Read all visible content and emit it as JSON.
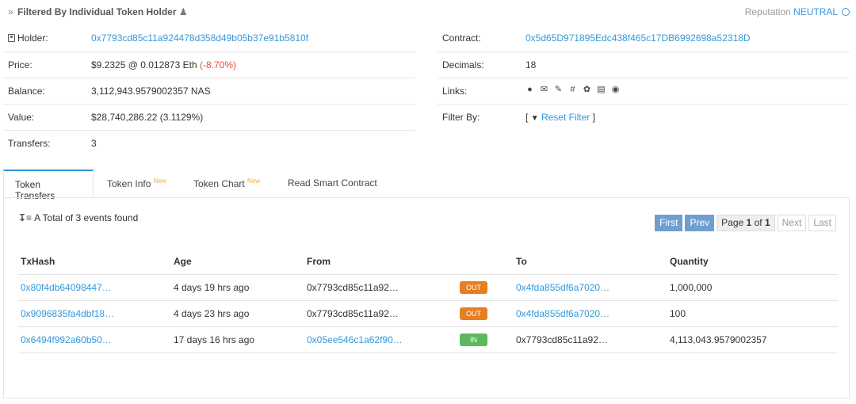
{
  "header": {
    "filter_title": "Filtered By Individual Token Holder",
    "reputation_label": "Reputation",
    "reputation_value": "NEUTRAL"
  },
  "overview_left": [
    {
      "label": "Holder:",
      "value": "0x7793cd85c11a924478d358d49b05b37e91b5810f",
      "is_link": true,
      "has_icon": true
    },
    {
      "label": "Price:",
      "value": "$9.2325 @ 0.012873 Eth",
      "change": "(-8.70%)"
    },
    {
      "label": "Balance:",
      "value": "3,112,943.9579002357 NAS"
    },
    {
      "label": "Value:",
      "value": "$28,740,286.22 (3.1129%)"
    },
    {
      "label": "Transfers:",
      "value": "3"
    }
  ],
  "overview_right": {
    "contract_label": "Contract:",
    "contract_value": "0x5d65D971895Edc438f465c17DB6992698a52318D",
    "decimals_label": "Decimals:",
    "decimals_value": "18",
    "links_label": "Links:",
    "links_icons": [
      "globe-icon",
      "mail-icon",
      "edit-icon",
      "slack-icon",
      "twitter-icon",
      "document-icon",
      "medium-icon"
    ],
    "filter_label": "Filter By:",
    "filter_open": "[",
    "reset_filter": "Reset Filter",
    "filter_close": "]"
  },
  "tabs": [
    {
      "label": "Token Transfers",
      "badge": "",
      "active": true
    },
    {
      "label": "Token Info",
      "badge": "New",
      "active": false
    },
    {
      "label": "Token Chart",
      "badge": "New",
      "active": false
    },
    {
      "label": "Read Smart Contract",
      "badge": "",
      "active": false
    }
  ],
  "transfers": {
    "total_text": "A Total of 3 events found",
    "pager": {
      "first": "First",
      "prev": "Prev",
      "page_prefix": "Page",
      "page_current": "1",
      "page_of": "of",
      "page_total": "1",
      "next": "Next",
      "last": "Last"
    },
    "columns": [
      "TxHash",
      "Age",
      "From",
      "",
      "To",
      "Quantity"
    ],
    "rows": [
      {
        "txhash": "0x80f4db64098447…",
        "age": "4 days 19 hrs ago",
        "from": "0x7793cd85c11a92…",
        "from_link": false,
        "direction": "OUT",
        "to": "0x4fda855df6a7020…",
        "to_link": true,
        "quantity": "1,000,000"
      },
      {
        "txhash": "0x9096835fa4dbf18…",
        "age": "4 days 23 hrs ago",
        "from": "0x7793cd85c11a92…",
        "from_link": false,
        "direction": "OUT",
        "to": "0x4fda855df6a7020…",
        "to_link": true,
        "quantity": "100"
      },
      {
        "txhash": "0x6494f992a60b50…",
        "age": "17 days 16 hrs ago",
        "from": "0x05ee546c1a62f90…",
        "from_link": true,
        "direction": "IN",
        "to": "0x7793cd85c11a92…",
        "to_link": false,
        "quantity": "4,113,043.9579002357"
      }
    ]
  },
  "colors": {
    "link": "#3498db",
    "negative": "#e74c3c",
    "out_badge": "#e87e22",
    "in_badge": "#5cb85c",
    "pager_active": "#6f9fcf"
  }
}
